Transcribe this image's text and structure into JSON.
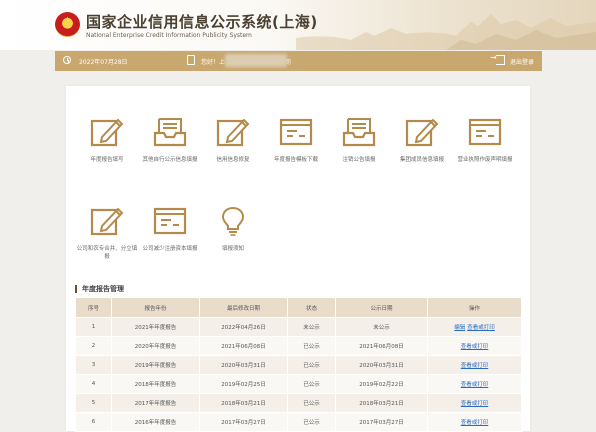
{
  "header": {
    "title": "国家企业信用信息公示系统(上海)",
    "subtitle": "National Enterprise Credit Information Publicity System"
  },
  "userbar": {
    "date": "2022年07月28日",
    "user_prefix": "您好！上",
    "user_suffix": "司",
    "logout": "退出登录"
  },
  "tiles": [
    {
      "label": "年度报告填写",
      "icon": "edit-form-icon"
    },
    {
      "label": "其他自行公示信息填报",
      "icon": "inbox-tray-icon"
    },
    {
      "label": "信用信息修复",
      "icon": "edit-form-icon"
    },
    {
      "label": "年度报告模板下载",
      "icon": "document-card-icon"
    },
    {
      "label": "注销公告填报",
      "icon": "inbox-tray-icon"
    },
    {
      "label": "集团成员信息填报",
      "icon": "edit-form-icon"
    },
    {
      "label": "营业执照作废声明填报",
      "icon": "document-card-icon"
    },
    {
      "label": "公司和农专合并、分立填报",
      "icon": "edit-form-icon"
    },
    {
      "label": "公司减少注册资本填报",
      "icon": "document-card-icon"
    },
    {
      "label": "填报须知",
      "icon": "lightbulb-icon"
    }
  ],
  "section_title": "年度报告管理",
  "table": {
    "headers": [
      "序号",
      "报告年份",
      "最后修改日期",
      "状态",
      "公示日期",
      "操作"
    ],
    "rows": [
      {
        "no": "1",
        "year": "2021年年度报告",
        "modified": "2022年04月26日",
        "status": "未公示",
        "published": "未公示",
        "actions": [
          "编辑",
          "查看或打印"
        ]
      },
      {
        "no": "2",
        "year": "2020年年度报告",
        "modified": "2021年06月08日",
        "status": "已公示",
        "published": "2021年06月08日",
        "actions": [
          "查看或打印"
        ]
      },
      {
        "no": "3",
        "year": "2019年年度报告",
        "modified": "2020年03月31日",
        "status": "已公示",
        "published": "2020年03月31日",
        "actions": [
          "查看或打印"
        ]
      },
      {
        "no": "4",
        "year": "2018年年度报告",
        "modified": "2019年02月25日",
        "status": "已公示",
        "published": "2019年02月22日",
        "actions": [
          "查看或打印"
        ]
      },
      {
        "no": "5",
        "year": "2017年年度报告",
        "modified": "2018年03月21日",
        "status": "已公示",
        "published": "2018年03月21日",
        "actions": [
          "查看或打印"
        ]
      },
      {
        "no": "6",
        "year": "2016年年度报告",
        "modified": "2017年03月27日",
        "status": "已公示",
        "published": "2017年03月27日",
        "actions": [
          "查看或打印"
        ]
      }
    ]
  },
  "colors": {
    "accent": "#c8a86f",
    "icon": "#b48a4a",
    "header_row": "#eadccb",
    "link": "#2b6cc0"
  }
}
